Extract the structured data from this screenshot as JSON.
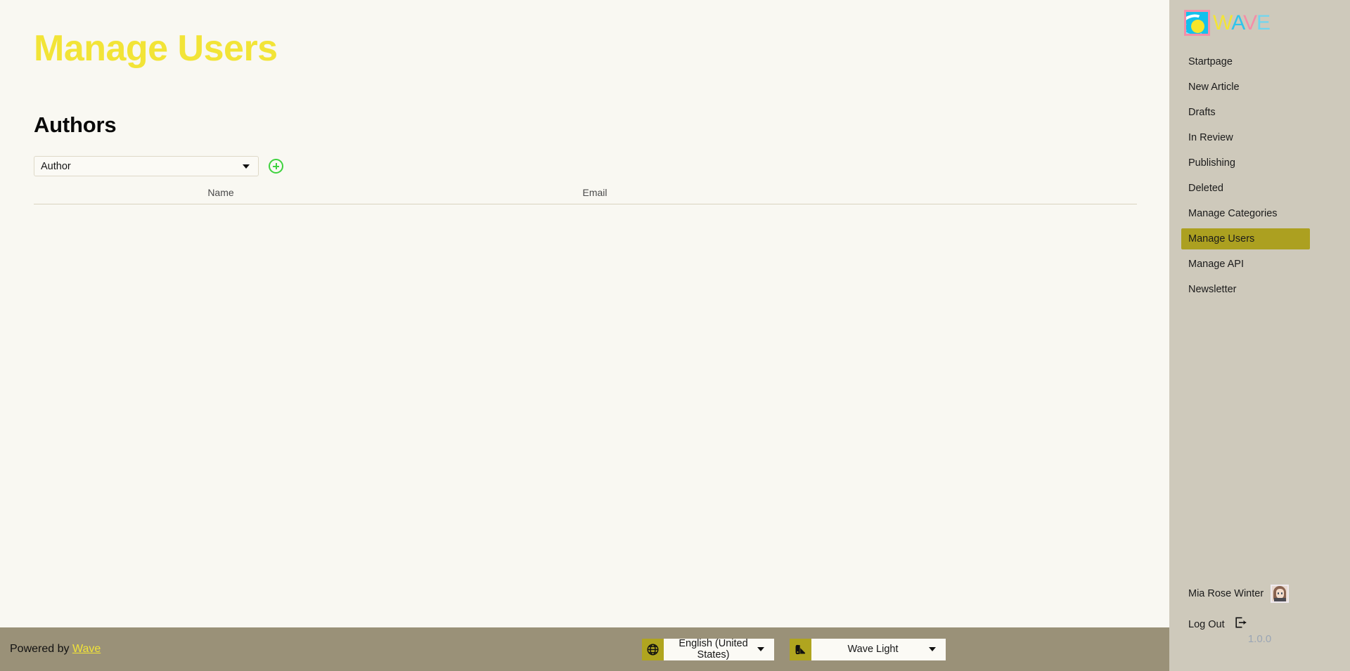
{
  "page": {
    "title": "Manage Users",
    "section_title": "Authors"
  },
  "colors": {
    "accent_yellow": "#f2e437",
    "sidebar_bg": "#cec9bb",
    "active_item": "#aca020",
    "footer_bg": "#9a9178",
    "content_bg": "#f9f8f2",
    "add_green": "#3ed23e",
    "icon_olive": "#b0a51f",
    "version_gray": "#9aa5b5"
  },
  "authors_control": {
    "select_value": "Author",
    "select_options": [
      "Author"
    ],
    "add_icon": "plus-circle-icon",
    "chevron_icon": "chevron-down-icon"
  },
  "table": {
    "columns": [
      "Name",
      "Email"
    ],
    "rows": []
  },
  "footer": {
    "powered_prefix": "Powered by ",
    "powered_link": "Wave",
    "language": {
      "icon": "globe-icon",
      "value": "English (United States)",
      "chevron_icon": "chevron-down-icon"
    },
    "theme": {
      "icon": "palette-icon",
      "value": "Wave Light",
      "chevron_icon": "chevron-down-icon"
    }
  },
  "sidebar": {
    "brand": {
      "logo_icon": "wave-logo-icon",
      "letters": [
        "W",
        "A",
        "V",
        "E"
      ]
    },
    "items": [
      {
        "label": "Startpage",
        "active": false
      },
      {
        "label": "New Article",
        "active": false
      },
      {
        "label": "Drafts",
        "active": false
      },
      {
        "label": "In Review",
        "active": false
      },
      {
        "label": "Publishing",
        "active": false
      },
      {
        "label": "Deleted",
        "active": false
      },
      {
        "label": "Manage Categories",
        "active": false
      },
      {
        "label": "Manage Users",
        "active": true
      },
      {
        "label": "Manage API",
        "active": false
      },
      {
        "label": "Newsletter",
        "active": false
      }
    ],
    "user": {
      "name": "Mia Rose Winter",
      "avatar_icon": "avatar"
    },
    "logout": {
      "label": "Log Out",
      "icon": "logout-icon"
    },
    "version": "1.0.0"
  }
}
